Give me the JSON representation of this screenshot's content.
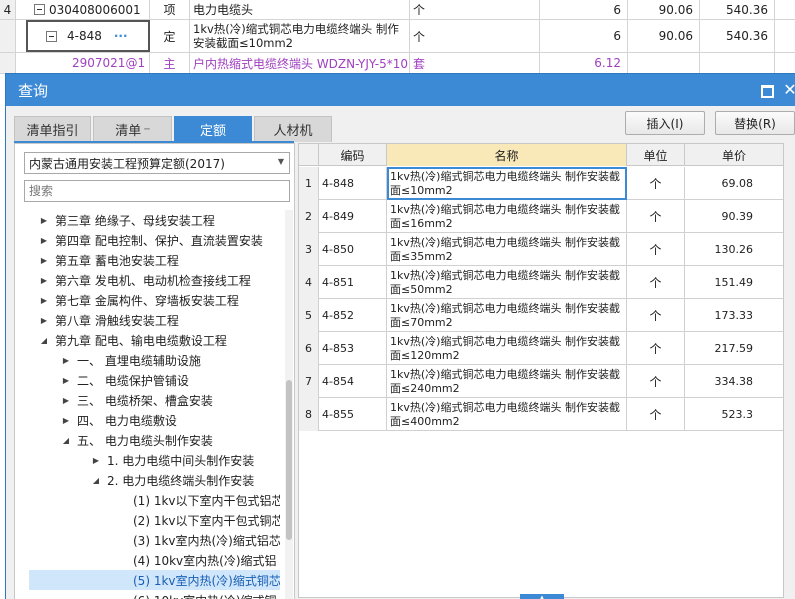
{
  "background_sheet": {
    "rows": [
      {
        "num": "4",
        "code": "030408006001",
        "type": "项",
        "name": "电力电缆头",
        "unit": "个",
        "qty": "6",
        "price": "90.06",
        "total": "540.36"
      },
      {
        "num": "",
        "code": "4-848",
        "type": "定",
        "name": "1kv热(冷)缩式铜芯电力电缆终端头 制作安装截面≤10mm2",
        "unit": "个",
        "qty": "6",
        "price": "90.06",
        "total": "540.36"
      },
      {
        "num": "",
        "code": "2907021@1",
        "type": "主",
        "name": "户内热缩式电缆终端头 WDZN-YJY-5*10",
        "unit": "套",
        "qty": "6.12",
        "price": "",
        "total": ""
      }
    ],
    "code_more": "···"
  },
  "dialog": {
    "title": "查询",
    "tabs": [
      {
        "label": "清单指引",
        "active": false
      },
      {
        "label": "清单",
        "active": false
      },
      {
        "label": "定额",
        "active": true
      },
      {
        "label": "人材机",
        "active": false
      }
    ],
    "insert_label": "插入(I)",
    "replace_label": "替换(R)"
  },
  "left": {
    "quota_book": "内蒙古通用安装工程预算定额(2017)",
    "search_placeholder": "搜索",
    "tree": [
      {
        "label": "第三章 绝缘子、母线安装工程",
        "level": 1,
        "toggle": "▶"
      },
      {
        "label": "第四章 配电控制、保护、直流装置安装",
        "level": 1,
        "toggle": "▶"
      },
      {
        "label": "第五章 蓄电池安装工程",
        "level": 1,
        "toggle": "▶"
      },
      {
        "label": "第六章 发电机、电动机检查接线工程",
        "level": 1,
        "toggle": "▶"
      },
      {
        "label": "第七章 金属构件、穿墙板安装工程",
        "level": 1,
        "toggle": "▶"
      },
      {
        "label": "第八章 滑触线安装工程",
        "level": 1,
        "toggle": "▶"
      },
      {
        "label": "第九章 配电、输电电缆敷设工程",
        "level": 1,
        "toggle": "◢"
      },
      {
        "label": "一、 直埋电缆辅助设施",
        "level": 2,
        "toggle": "▶"
      },
      {
        "label": "二、 电缆保护管铺设",
        "level": 2,
        "toggle": "▶"
      },
      {
        "label": "三、 电缆桥架、槽盒安装",
        "level": 2,
        "toggle": "▶"
      },
      {
        "label": "四、 电力电缆敷设",
        "level": 2,
        "toggle": "▶"
      },
      {
        "label": "五、 电力电缆头制作安装",
        "level": 2,
        "toggle": "◢"
      },
      {
        "label": "1. 电力电缆中间头制作安装",
        "level": 3,
        "toggle": "▶"
      },
      {
        "label": "2. 电力电缆终端头制作安装",
        "level": 3,
        "toggle": "◢"
      },
      {
        "label": "(1) 1kv以下室内干包式铝芯",
        "level": 4,
        "toggle": ""
      },
      {
        "label": "(2) 1kv以下室内干包式铜芯",
        "level": 4,
        "toggle": ""
      },
      {
        "label": "(3) 1kv室内热(冷)缩式铝芯",
        "level": 4,
        "toggle": ""
      },
      {
        "label": "(4) 10kv室内热(冷)缩式铝",
        "level": 4,
        "toggle": ""
      },
      {
        "label": "(5) 1kv室内热(冷)缩式铜芯",
        "level": 4,
        "toggle": "",
        "selected": true
      },
      {
        "label": "(6) 10kv室内热(冷)缩式铜",
        "level": 4,
        "toggle": ""
      }
    ]
  },
  "grid": {
    "headers": {
      "code": "编码",
      "name": "名称",
      "unit": "单位",
      "price": "单价"
    },
    "rows": [
      {
        "idx": "1",
        "code": "4-848",
        "name": "1kv热(冷)缩式铜芯电力电缆终端头 制作安装截面≤10mm2",
        "unit": "个",
        "price": "69.08"
      },
      {
        "idx": "2",
        "code": "4-849",
        "name": "1kv热(冷)缩式铜芯电力电缆终端头 制作安装截面≤16mm2",
        "unit": "个",
        "price": "90.39"
      },
      {
        "idx": "3",
        "code": "4-850",
        "name": "1kv热(冷)缩式铜芯电力电缆终端头 制作安装截面≤35mm2",
        "unit": "个",
        "price": "130.26"
      },
      {
        "idx": "4",
        "code": "4-851",
        "name": "1kv热(冷)缩式铜芯电力电缆终端头 制作安装截面≤50mm2",
        "unit": "个",
        "price": "151.49"
      },
      {
        "idx": "5",
        "code": "4-852",
        "name": "1kv热(冷)缩式铜芯电力电缆终端头 制作安装截面≤70mm2",
        "unit": "个",
        "price": "173.33"
      },
      {
        "idx": "6",
        "code": "4-853",
        "name": "1kv热(冷)缩式铜芯电力电缆终端头 制作安装截面≤120mm2",
        "unit": "个",
        "price": "217.59"
      },
      {
        "idx": "7",
        "code": "4-854",
        "name": "1kv热(冷)缩式铜芯电力电缆终端头 制作安装截面≤240mm2",
        "unit": "个",
        "price": "334.38"
      },
      {
        "idx": "8",
        "code": "4-855",
        "name": "1kv热(冷)缩式铜芯电力电缆终端头 制作安装截面≤400mm2",
        "unit": "个",
        "price": "523.3"
      }
    ]
  },
  "colors": {
    "accent": "#3c8ad6",
    "header_name": "#f9e8b8",
    "selected_tree": "#cfe6fb",
    "main_material_text": "#a040c0"
  }
}
